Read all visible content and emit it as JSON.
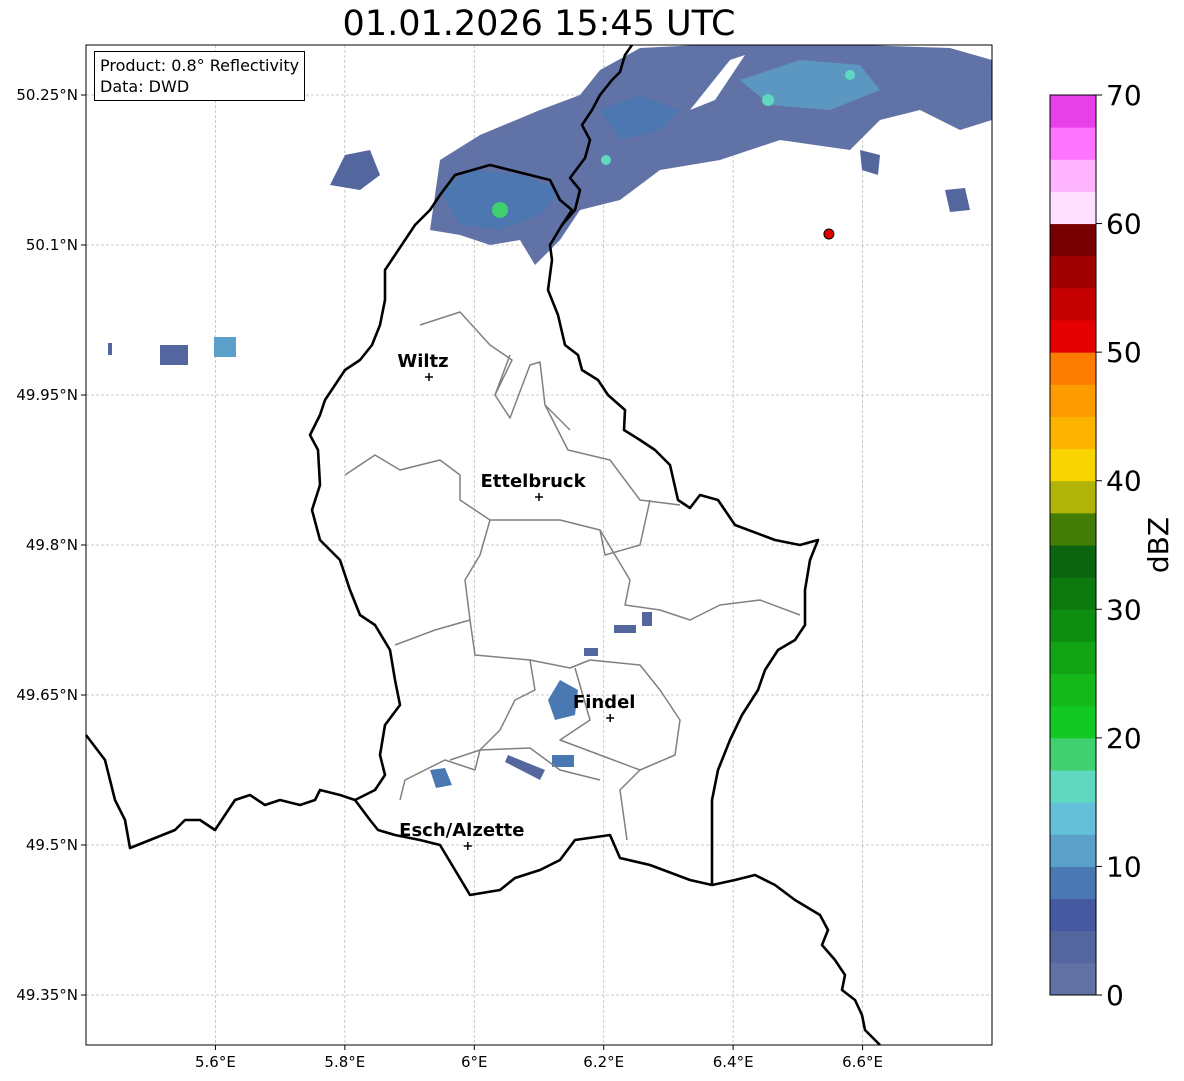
{
  "title": "01.01.2026 15:45 UTC",
  "info": {
    "product": "Product: 0.8° Reflectivity",
    "source": "Data: DWD"
  },
  "map": {
    "lon_range": [
      5.4,
      6.8
    ],
    "lat_range": [
      49.3,
      50.3
    ],
    "x_ticks": [
      {
        "value": 5.6,
        "label": "5.6°E"
      },
      {
        "value": 5.8,
        "label": "5.8°E"
      },
      {
        "value": 6.0,
        "label": "6°E"
      },
      {
        "value": 6.2,
        "label": "6.2°E"
      },
      {
        "value": 6.4,
        "label": "6.4°E"
      },
      {
        "value": 6.6,
        "label": "6.6°E"
      }
    ],
    "y_ticks": [
      {
        "value": 50.25,
        "label": "50.25°N"
      },
      {
        "value": 50.1,
        "label": "50.1°N"
      },
      {
        "value": 49.95,
        "label": "49.95°N"
      },
      {
        "value": 49.8,
        "label": "49.8°N"
      },
      {
        "value": 49.65,
        "label": "49.65°N"
      },
      {
        "value": 49.5,
        "label": "49.5°N"
      },
      {
        "value": 49.35,
        "label": "49.35°N"
      }
    ],
    "cities": [
      {
        "name": "Wiltz",
        "lon": 5.93,
        "lat": 49.968
      },
      {
        "name": "Ettelbruck",
        "lon": 6.1,
        "lat": 49.848
      },
      {
        "name": "Findel",
        "lon": 6.21,
        "lat": 49.627
      },
      {
        "name": "Esch/Alzette",
        "lon": 5.99,
        "lat": 49.499
      }
    ],
    "radar_site": {
      "lon": 6.548,
      "lat": 50.111,
      "color": "#e00000"
    }
  },
  "colorbar": {
    "label": "dBZ",
    "ticks": [
      0,
      10,
      20,
      30,
      40,
      50,
      60,
      70
    ],
    "min": 0,
    "max": 70,
    "colors": [
      "#6272a4",
      "#54669e",
      "#44599f",
      "#4a78b2",
      "#5aa0c8",
      "#64c0d8",
      "#60d8c0",
      "#40d070",
      "#12c822",
      "#14b81a",
      "#12a414",
      "#0e8e10",
      "#0c7a0e",
      "#0a6410",
      "#447c08",
      "#b0b408",
      "#f8d400",
      "#fcb400",
      "#fc9c00",
      "#fc7c00",
      "#e40000",
      "#c40000",
      "#a00000",
      "#780000",
      "#ffe0ff",
      "#ffb4ff",
      "#ff74ff",
      "#e840e8"
    ]
  }
}
